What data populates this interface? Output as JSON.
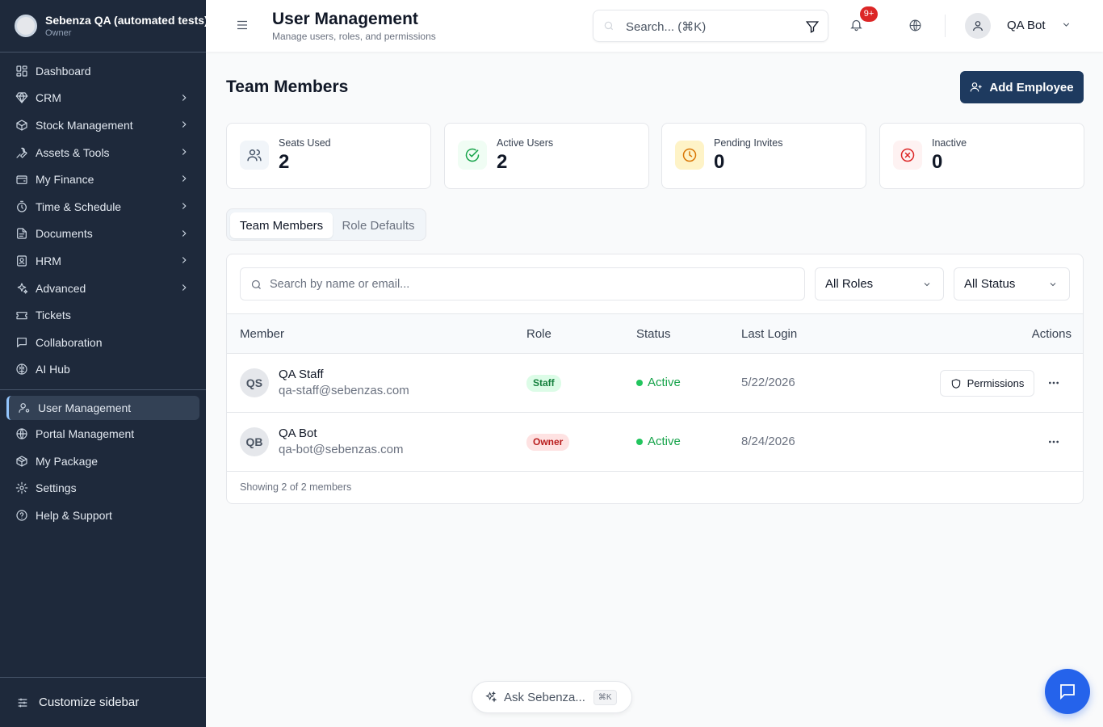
{
  "org": {
    "name": "Sebenza QA (automated tests)",
    "role": "Owner"
  },
  "sidebar": {
    "items": [
      {
        "label": "Dashboard",
        "icon": "dashboard-icon",
        "has_submenu": false
      },
      {
        "label": "CRM",
        "icon": "gem-icon",
        "has_submenu": true
      },
      {
        "label": "Stock Management",
        "icon": "box-icon",
        "has_submenu": true
      },
      {
        "label": "Assets & Tools",
        "icon": "wrench-icon",
        "has_submenu": true
      },
      {
        "label": "My Finance",
        "icon": "wallet-icon",
        "has_submenu": true
      },
      {
        "label": "Time & Schedule",
        "icon": "timer-icon",
        "has_submenu": true
      },
      {
        "label": "Documents",
        "icon": "file-icon",
        "has_submenu": true
      },
      {
        "label": "HRM",
        "icon": "hrm-icon",
        "has_submenu": true
      },
      {
        "label": "Advanced",
        "icon": "sparkles-icon",
        "has_submenu": true
      },
      {
        "label": "Tickets",
        "icon": "ticket-icon",
        "has_submenu": false
      },
      {
        "label": "Collaboration",
        "icon": "message-icon",
        "has_submenu": false
      },
      {
        "label": "AI Hub",
        "icon": "brain-icon",
        "has_submenu": false
      }
    ],
    "admin_items": [
      {
        "label": "User Management",
        "icon": "user-cog-icon",
        "active": true
      },
      {
        "label": "Portal Management",
        "icon": "globe-icon",
        "active": false
      },
      {
        "label": "My Package",
        "icon": "package-icon",
        "active": false
      },
      {
        "label": "Settings",
        "icon": "settings-icon",
        "active": false
      },
      {
        "label": "Help & Support",
        "icon": "help-icon",
        "active": false
      }
    ],
    "customize_label": "Customize sidebar"
  },
  "header": {
    "title": "User Management",
    "subtitle": "Manage users, roles, and permissions",
    "search_placeholder": "Search... (⌘K)",
    "notification_badge": "9+",
    "user_name": "QA Bot"
  },
  "main": {
    "title": "Team Members",
    "add_button": "Add Employee",
    "stats": [
      {
        "label": "Seats Used",
        "value": "2",
        "icon": "users-icon",
        "color": "#475569",
        "bg": "#f1f5f9"
      },
      {
        "label": "Active Users",
        "value": "2",
        "icon": "check-circle-icon",
        "color": "#16a34a",
        "bg": "#f0fdf4"
      },
      {
        "label": "Pending Invites",
        "value": "0",
        "icon": "clock-icon",
        "color": "#d97706",
        "bg": "#fef3c7"
      },
      {
        "label": "Inactive",
        "value": "0",
        "icon": "x-circle-icon",
        "color": "#dc2626",
        "bg": "#fef2f2"
      }
    ],
    "tabs": [
      {
        "label": "Team Members",
        "active": true
      },
      {
        "label": "Role Defaults",
        "active": false
      }
    ],
    "member_search_placeholder": "Search by name or email...",
    "role_filter": "All Roles",
    "status_filter": "All Status",
    "columns": {
      "member": "Member",
      "role": "Role",
      "status": "Status",
      "last_login": "Last Login",
      "actions": "Actions"
    },
    "members": [
      {
        "initials": "QS",
        "name": "QA Staff",
        "email": "qa-staff@sebenzas.com",
        "role": "Staff",
        "status": "Active",
        "last_login": "5/22/2026",
        "permissions_label": "Permissions"
      },
      {
        "initials": "QB",
        "name": "QA Bot",
        "email": "qa-bot@sebenzas.com",
        "role": "Owner",
        "status": "Active",
        "last_login": "8/24/2026"
      }
    ],
    "footer": "Showing 2 of 2 members"
  },
  "assistant": {
    "label": "Ask Sebenza...",
    "shortcut": "⌘K"
  }
}
